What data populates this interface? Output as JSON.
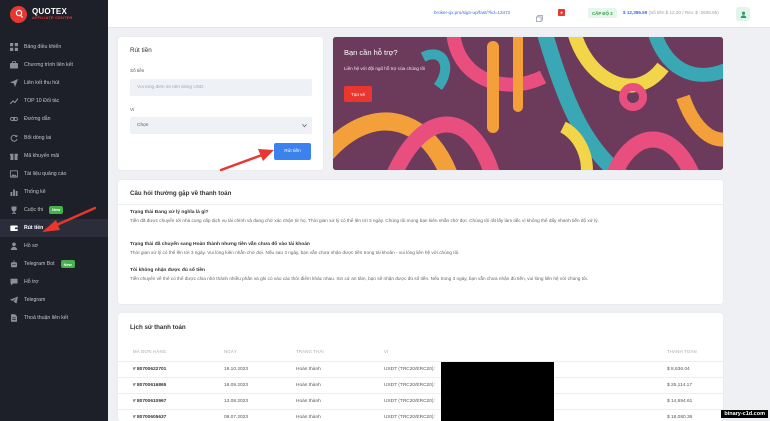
{
  "brand": {
    "name": "QUOTEX",
    "subtitle": "AFFILIATE CENTER"
  },
  "sidebar": {
    "items": [
      {
        "label": "Bảng điều khiển",
        "icon": "grid-icon"
      },
      {
        "label": "Chương trình liên kết",
        "icon": "briefcase-icon"
      },
      {
        "label": "Liên kết thu hút",
        "icon": "send-icon"
      },
      {
        "label": "TOP 10 Đối tác",
        "icon": "chart-up-icon"
      },
      {
        "label": "Đường dẫn",
        "icon": "link-icon"
      },
      {
        "label": "Bổi dòng lai",
        "icon": "refresh-icon"
      },
      {
        "label": "Mã khuyến mãi",
        "icon": "gift-icon"
      },
      {
        "label": "Tài liệu quảng cáo",
        "icon": "image-icon"
      },
      {
        "label": "Thống kê",
        "icon": "stats-icon"
      },
      {
        "label": "Cuộc thi",
        "icon": "trophy-icon",
        "badge": "New"
      },
      {
        "label": "Rút tiền",
        "icon": "wallet-icon",
        "active": true
      },
      {
        "label": "Hồ sơ",
        "icon": "user-icon"
      },
      {
        "label": "Telegram Bot",
        "icon": "bot-icon",
        "badge": "New"
      },
      {
        "label": "Hỗ trợ",
        "icon": "support-icon"
      },
      {
        "label": "Telegram",
        "icon": "telegram-icon"
      },
      {
        "label": "Thoả thuận liên kết",
        "icon": "document-icon"
      }
    ]
  },
  "topbar": {
    "ref_link": "broker-qx.pro/sign-up/fast/?lid=13472",
    "level": "CẤP ĐỘ 2",
    "balance": "$ 12,386.59",
    "balance_detail": "(Số tiền $ 12,00 / Rev. $ -2836.85)"
  },
  "withdraw": {
    "title": "Rút tiền",
    "amount_label": "Số tiền",
    "amount_placeholder": "Vui lòng điền số tiền bằng USD",
    "wallet_label": "Ví",
    "wallet_value": "Chọn",
    "submit_label": "Rút tiền"
  },
  "help": {
    "title": "Bạn cần hỗ trợ?",
    "subtitle": "Liên hệ với đội ngũ hỗ trợ của chúng tôi",
    "button_label": "Tạo vé"
  },
  "faq": {
    "title": "Câu hỏi thường gặp về thanh toán",
    "items": [
      {
        "q": "Trạng thái Đang xử lý nghĩa là gì?",
        "a": "Tiền đã được chuyển tới nhà cung cấp dịch vụ tài chính và đang chờ xác nhận từ họ. Thời gian xử lý có thể lên tới 3 ngày. Chúng tôi mong bạn kiên nhẫn chờ đợi. Chúng tôi rất lấy làm tiếc vì không thể đẩy nhanh tiến độ xử lý."
      },
      {
        "q": "Trạng thái đã chuyển sang Hoàn thành nhưng tiền vẫn chưa đổ vào tài khoản",
        "a": "Thời gian xử lý có thể lên tới 3 ngày. Vui lòng kiên nhẫn chờ đợi. Nếu sau 3 ngày, bạn vẫn chưa nhận được tiền trong tài khoản - vui lòng liên hệ với chúng tôi."
      },
      {
        "q": "Tôi không nhận được đủ số tiền",
        "a": "Tiền chuyển về thẻ có thể được chia nhỏ thành nhiều phần và ghi có vào các thời điểm khác nhau. Xin cứ an tâm, bạn sẽ nhận được đủ số tiền. Nếu trong 3 ngày, bạn vẫn chưa nhận đủ tiền, vui lòng liên hệ với chúng tôi."
      }
    ]
  },
  "history": {
    "title": "Lịch sử thanh toán",
    "headers": [
      "MÃ ĐƠN HÀNG",
      "NGÀY",
      "TRẠNG THÁI",
      "VÍ",
      "THANH TOÁN"
    ],
    "rows": [
      {
        "id": "# 80700622701",
        "date": "19.10.2023",
        "status": "Hoàn thành",
        "wallet": "USDT (TRC20/ERC20):",
        "amount": "$ 8,636.04"
      },
      {
        "id": "# 80700616865",
        "date": "18.09.2023",
        "status": "Hoàn thành",
        "wallet": "USDT (TRC20/ERC20):",
        "amount": "$ 25,114.17"
      },
      {
        "id": "# 80700610967",
        "date": "13.08.2023",
        "status": "Hoàn thành",
        "wallet": "USDT (TRC20/ERC20):",
        "amount": "$ 14,694.61"
      },
      {
        "id": "# 80700605637",
        "date": "08.07.2023",
        "status": "Hoàn thành",
        "wallet": "USDT (TRC20/ERC20):",
        "amount": "$ 16,080.36"
      }
    ]
  },
  "watermark": "binary-c1d.com",
  "colors": {
    "accent_red": "#e9362f",
    "primary_blue": "#3b82f0",
    "sidebar_bg": "#1e2029",
    "success_green": "#47b04b"
  }
}
